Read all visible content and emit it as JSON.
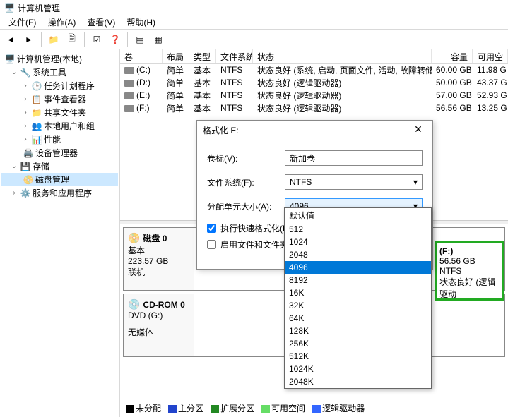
{
  "window_title": "计算机管理",
  "menu": [
    "文件(F)",
    "操作(A)",
    "查看(V)",
    "帮助(H)"
  ],
  "tree": {
    "root": "计算机管理(本地)",
    "sys_tools": "系统工具",
    "task": "任务计划程序",
    "event": "事件查看器",
    "shared": "共享文件夹",
    "users": "本地用户和组",
    "perf": "性能",
    "devmgr": "设备管理器",
    "storage": "存储",
    "diskmgmt": "磁盘管理",
    "services": "服务和应用程序"
  },
  "vol_hdr": {
    "vol": "卷",
    "layout": "布局",
    "type": "类型",
    "fs": "文件系统",
    "status": "状态",
    "cap": "容量",
    "free": "可用空"
  },
  "vols": [
    {
      "drive": "(C:)",
      "layout": "简单",
      "type": "基本",
      "fs": "NTFS",
      "status": "状态良好 (系统, 启动, 页面文件, 活动, 故障转储, 主分区)",
      "cap": "60.00 GB",
      "free": "11.98 G"
    },
    {
      "drive": "(D:)",
      "layout": "简单",
      "type": "基本",
      "fs": "NTFS",
      "status": "状态良好 (逻辑驱动器)",
      "cap": "50.00 GB",
      "free": "43.37 G"
    },
    {
      "drive": "(E:)",
      "layout": "简单",
      "type": "基本",
      "fs": "NTFS",
      "status": "状态良好 (逻辑驱动器)",
      "cap": "57.00 GB",
      "free": "52.93 G"
    },
    {
      "drive": "(F:)",
      "layout": "简单",
      "type": "基本",
      "fs": "NTFS",
      "status": "状态良好 (逻辑驱动器)",
      "cap": "56.56 GB",
      "free": "13.25 G"
    }
  ],
  "disk0": {
    "title": "磁盘 0",
    "type": "基本",
    "size": "223.57 GB",
    "state": "联机"
  },
  "cdrom": {
    "title": "CD-ROM 0",
    "drive": "DVD (G:)",
    "state": "无媒体"
  },
  "legend": {
    "unalloc": "未分配",
    "primary": "主分区",
    "ext": "扩展分区",
    "free": "可用空间",
    "logical": "逻辑驱动器"
  },
  "dialog": {
    "title": "格式化 E:",
    "label_vol": "卷标(V):",
    "val_vol": "新加卷",
    "label_fs": "文件系统(F):",
    "val_fs": "NTFS",
    "label_au": "分配单元大小(A):",
    "val_au": "4096",
    "chk_quick": "执行快速格式化(P)",
    "chk_compress": "启用文件和文件夹压缩(E)"
  },
  "dropdown": [
    "默认值",
    "512",
    "1024",
    "2048",
    "4096",
    "8192",
    "16K",
    "32K",
    "64K",
    "128K",
    "256K",
    "512K",
    "1024K",
    "2048K"
  ],
  "fpart": {
    "drive": "(F:)",
    "size": "56.56 GB NTFS",
    "status": "状态良好 (逻辑驱动"
  }
}
